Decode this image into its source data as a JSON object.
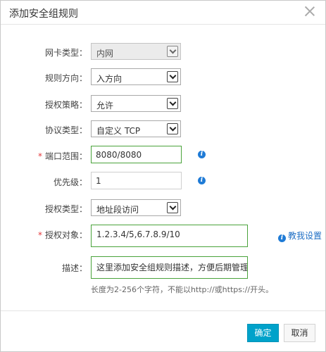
{
  "dialog": {
    "title": "添加安全组规则"
  },
  "form": {
    "nic_type": {
      "label": "网卡类型：",
      "value": "内网"
    },
    "direction": {
      "label": "规则方向：",
      "value": "入方向"
    },
    "policy": {
      "label": "授权策略：",
      "value": "允许"
    },
    "protocol": {
      "label": "协议类型：",
      "value": "自定义 TCP"
    },
    "port_range": {
      "required_mark": "*",
      "label": "端口范围：",
      "value": "8080/8080"
    },
    "priority": {
      "label": "优先级：",
      "value": "1"
    },
    "auth_type": {
      "label": "授权类型：",
      "value": "地址段访问"
    },
    "auth_object": {
      "required_mark": "*",
      "label": "授权对象：",
      "value": "1.2.3.4/5,6.7.8.9/10",
      "help_link": "教我设置"
    },
    "description": {
      "label": "描述：",
      "value": "这里添加安全组规则描述，方便后期管理",
      "hint": "长度为2-256个字符，不能以http://或https://开头。"
    }
  },
  "footer": {
    "confirm_label": "确定",
    "cancel_label": "取消"
  },
  "icons": {
    "info": "info-icon",
    "close": "close-icon",
    "dropdown": "chevron-down-icon"
  },
  "colors": {
    "primary_button": "#00a2ca",
    "focus_border": "#4aa33b",
    "required": "#e4393c",
    "link": "#1f6fc5",
    "info_icon": "#1f7bd6"
  }
}
